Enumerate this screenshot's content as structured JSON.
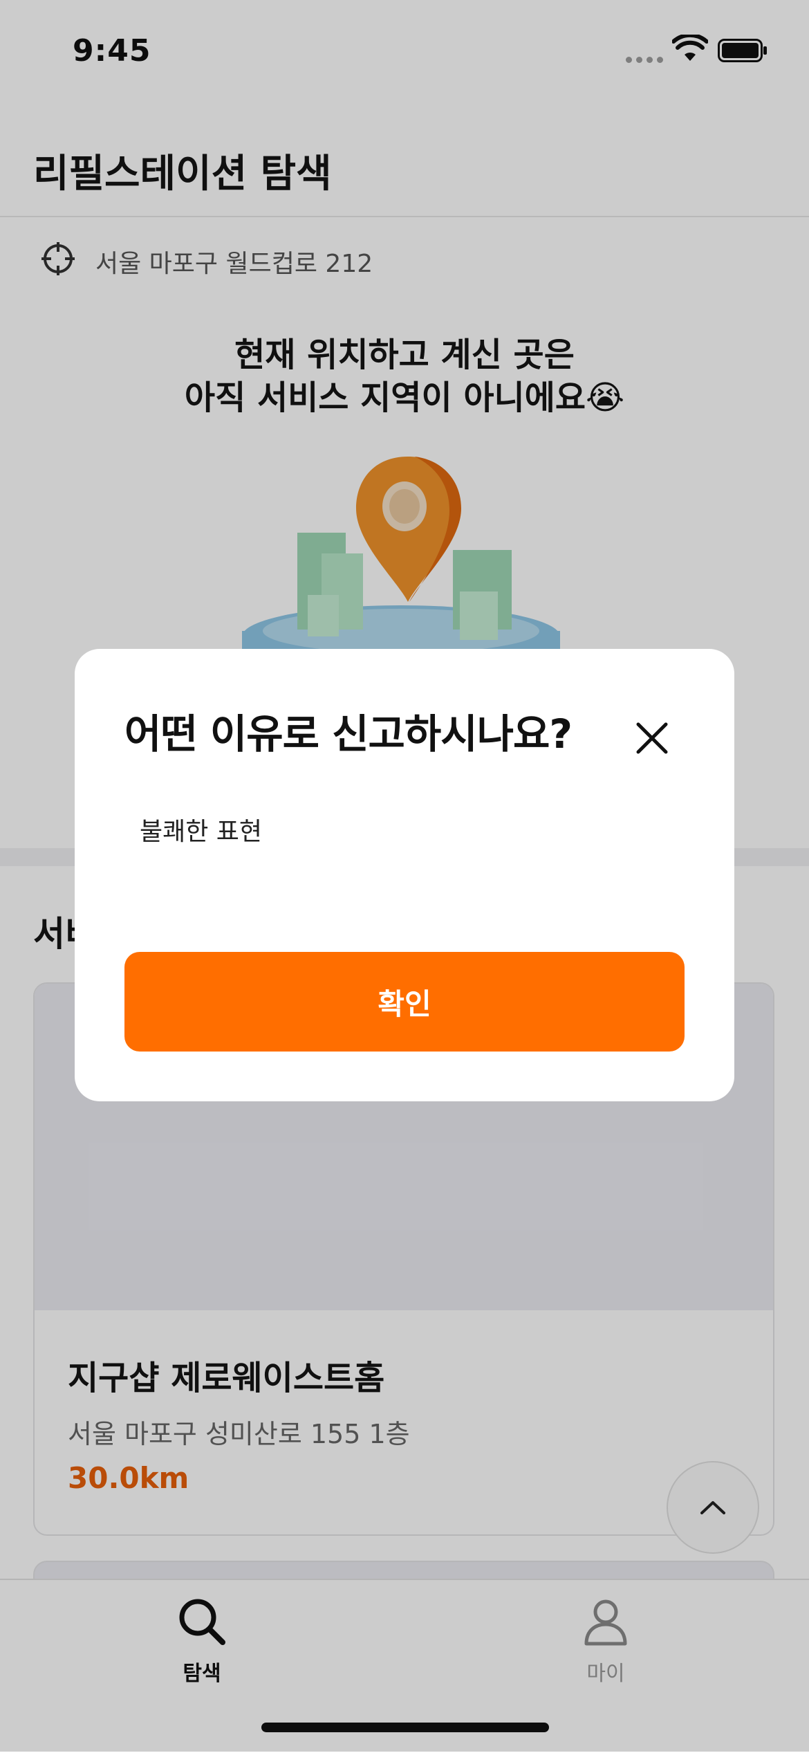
{
  "status_bar": {
    "time": "9:45"
  },
  "header": {
    "title": "리필스테이션 탐색"
  },
  "location": {
    "address": "서울 마포구 월드컵로 212"
  },
  "notice": {
    "line1": "현재 위치하고 계신 곳은",
    "line2": "아직 서비스 지역이 아니에요😭"
  },
  "section": {
    "title_partial": "서비"
  },
  "store": {
    "name": "지구샵 제로웨이스트홈",
    "address": "서울 마포구 성미산로 155 1층",
    "distance": "30.0km"
  },
  "tabs": [
    {
      "label": "탐색",
      "icon": "search-icon",
      "active": true
    },
    {
      "label": "마이",
      "icon": "person-icon",
      "active": false
    }
  ],
  "modal": {
    "title": "어떤 이유로 신고하시나요?",
    "input_value": "불쾌한 표현",
    "confirm_label": "확인"
  },
  "colors": {
    "accent": "#ff6e00",
    "distance": "#e8600a",
    "caret": "#3a63e8"
  }
}
